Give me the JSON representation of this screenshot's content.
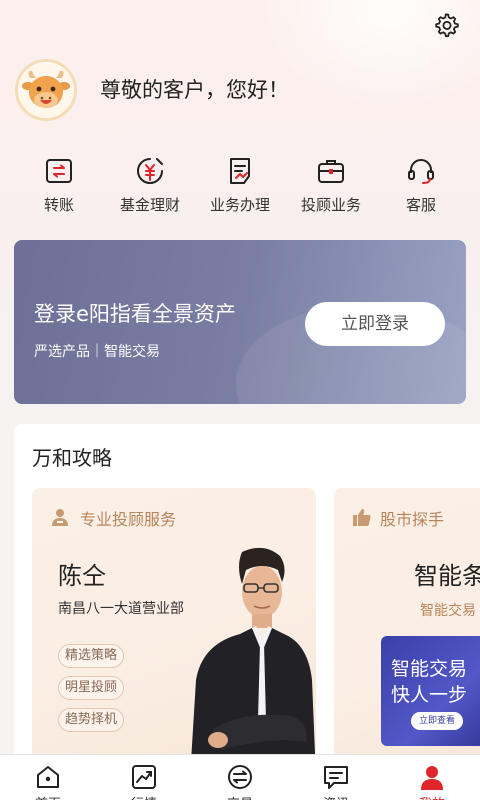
{
  "header": {
    "greeting": "尊敬的客户，您好！",
    "settings_icon": "gear-icon",
    "avatar_icon": "cow-mascot-avatar"
  },
  "quick_actions": [
    {
      "label": "转账",
      "icon": "transfer-icon"
    },
    {
      "label": "基金理财",
      "icon": "fund-icon"
    },
    {
      "label": "业务办理",
      "icon": "business-icon"
    },
    {
      "label": "投顾业务",
      "icon": "briefcase-icon"
    },
    {
      "label": "客服",
      "icon": "headset-icon"
    }
  ],
  "login_card": {
    "title": "登录e阳指看全景资产",
    "subtitle": "严选产品｜智能交易",
    "button": "立即登录"
  },
  "strategy": {
    "title": "万和攻略",
    "advisor_card": {
      "header": "专业投顾服务",
      "name": "陈仝",
      "branch": "南昌八一大道营业部",
      "tags": [
        "精选策略",
        "明星投顾",
        "趋势择机"
      ]
    },
    "stock_card": {
      "header": "股市探手",
      "title": "智能条",
      "subtitle": "智能交易",
      "promo_line1": "智能交易",
      "promo_line2": "快人一步",
      "promo_button": "立即查看"
    }
  },
  "tabbar": [
    {
      "label": "首页",
      "icon": "home-icon"
    },
    {
      "label": "行情",
      "icon": "chart-icon"
    },
    {
      "label": "交易",
      "icon": "exchange-icon"
    },
    {
      "label": "资讯",
      "icon": "message-icon"
    },
    {
      "label": "我的",
      "icon": "user-icon",
      "active": true
    }
  ],
  "colors": {
    "accent_red": "#e0242b",
    "gold_text": "#b8855b",
    "login_card_bg": "#7a7ea3"
  }
}
